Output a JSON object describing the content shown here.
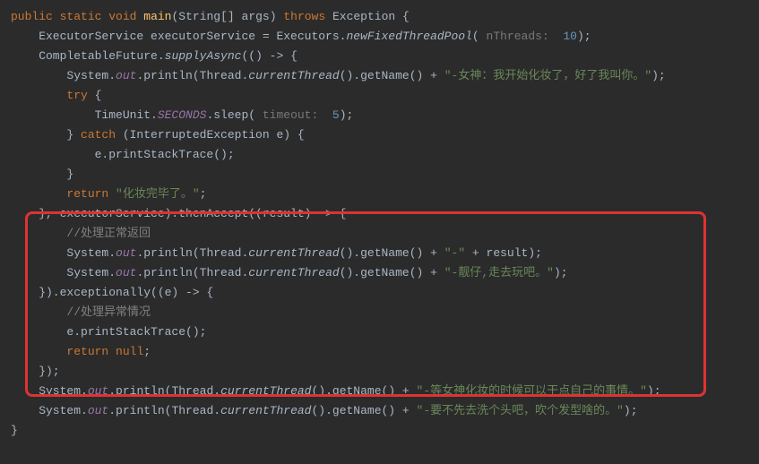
{
  "code": {
    "l1": {
      "kw_public": "public",
      "kw_static": "static",
      "kw_void": "void",
      "method": "main",
      "params": "(String[] args)",
      "kw_throws": "throws",
      "exception": "Exception",
      "brace": " {"
    },
    "l2": {
      "text1": "    ExecutorService executorService = Executors.",
      "static_method": "newFixedThreadPool",
      "text2": "( ",
      "hint": "nThreads: ",
      "num": " 10",
      "text3": ");"
    },
    "l3": {
      "text1": "    CompletableFuture.",
      "static_method": "supplyAsync",
      "text2": "(() -> {"
    },
    "l4": {
      "text1": "        System.",
      "field": "out",
      "text2": ".println(Thread.",
      "static_method": "currentThread",
      "text3": "().getName() + ",
      "str": "\"-女神：我开始化妆了，好了我叫你。\"",
      "text4": ");"
    },
    "l5": {
      "text1": "        ",
      "kw": "try",
      "text2": " {"
    },
    "l6": {
      "text1": "            TimeUnit.",
      "field": "SECONDS",
      "text2": ".sleep( ",
      "hint": "timeout: ",
      "num": " 5",
      "text3": ");"
    },
    "l7": {
      "text1": "        } ",
      "kw": "catch",
      "text2": " (InterruptedException e) {"
    },
    "l8": {
      "text1": "            e.printStackTrace();"
    },
    "l9": {
      "text1": "        }"
    },
    "l10": {
      "text1": "        ",
      "kw": "return",
      "text2": " ",
      "str": "\"化妆完毕了。\"",
      "text3": ";"
    },
    "l11": {
      "text1": "    }, executorService).thenAccept((result) -> {"
    },
    "l12": {
      "text1": "        ",
      "comment": "//处理正常返回"
    },
    "l13": {
      "text1": "        System.",
      "field": "out",
      "text2": ".println(Thread.",
      "static_method": "currentThread",
      "text3": "().getName() + ",
      "str": "\"-\"",
      "text4": " + result);"
    },
    "l14": {
      "text1": "        System.",
      "field": "out",
      "text2": ".println(Thread.",
      "static_method": "currentThread",
      "text3": "().getName() + ",
      "str": "\"-靓仔,走去玩吧。\"",
      "text4": ");"
    },
    "l15": {
      "text1": "    }).exceptionally((e) -> {"
    },
    "l16": {
      "text1": "        ",
      "comment": "//处理异常情况"
    },
    "l17": {
      "text1": "        e.printStackTrace();"
    },
    "l18": {
      "text1": "        ",
      "kw": "return",
      "text2": " ",
      "kw2": "null",
      "text3": ";"
    },
    "l19": {
      "text1": "    });"
    },
    "l20": {
      "text1": "    System.",
      "field": "out",
      "text2": ".println(Thread.",
      "static_method": "currentThread",
      "text3": "().getName() + ",
      "str": "\"-等女神化妆的时候可以干点自己的事情。\"",
      "text4": ");"
    },
    "l21": {
      "text1": "    System.",
      "field": "out",
      "text2": ".println(Thread.",
      "static_method": "currentThread",
      "text3": "().getName() + ",
      "str": "\"-要不先去洗个头吧，吹个发型啥的。\"",
      "text4": ");"
    },
    "l22": {
      "text1": "}"
    }
  }
}
